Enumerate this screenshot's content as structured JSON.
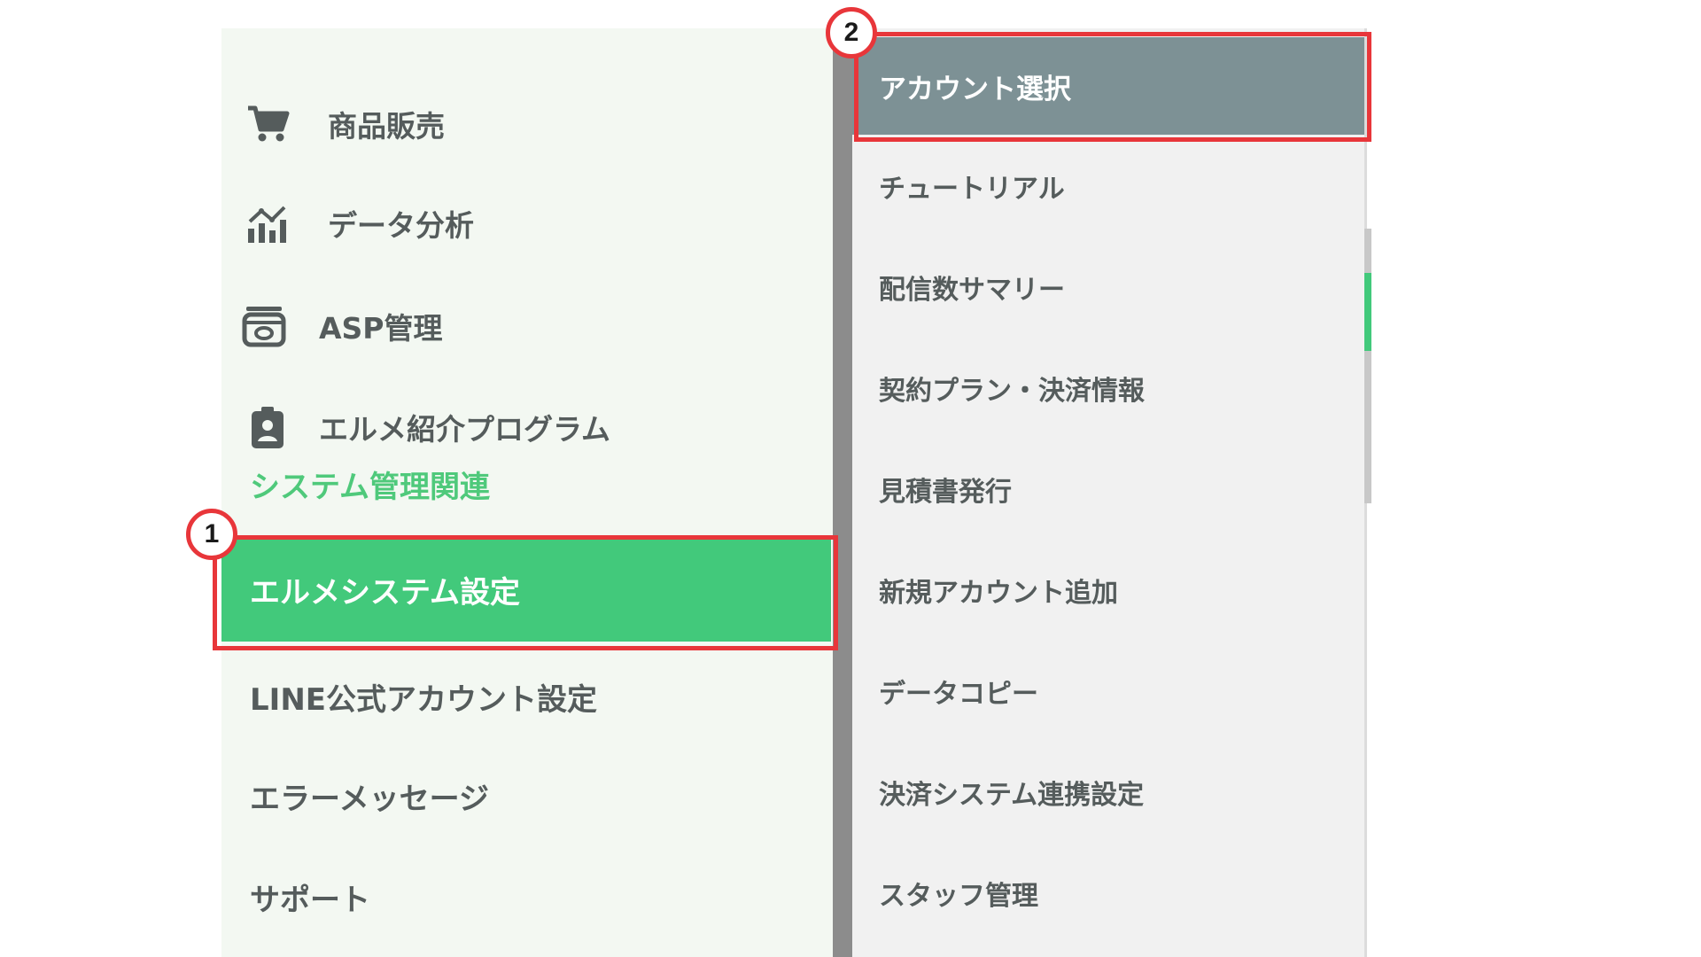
{
  "sidebar": {
    "items": [
      {
        "label": "商品販売",
        "icon": "cart-icon"
      },
      {
        "label": "データ分析",
        "icon": "analytics-chart-icon"
      },
      {
        "label": "ASP管理",
        "icon": "asp-box-icon"
      },
      {
        "label": "エルメ紹介プログラム",
        "icon": "badge-person-icon"
      }
    ],
    "section_label": "システム管理関連",
    "active_item": "エルメシステム設定",
    "plain_items": [
      "LINE公式アカウント設定",
      "エラーメッセージ",
      "サポート"
    ]
  },
  "submenu": {
    "active_item": "アカウント選択",
    "items": [
      "チュートリアル",
      "配信数サマリー",
      "契約プラン・決済情報",
      "見積書発行",
      "新規アカウント追加",
      "データコピー",
      "決済システム連携設定",
      "スタッフ管理"
    ]
  },
  "annotations": {
    "badge_1": "1",
    "badge_2": "2",
    "highlight_color": "#e8363a"
  },
  "colors": {
    "accent_green": "#42c97b",
    "section_green": "#4fc97b",
    "submenu_active": "#7d9195",
    "sidebar_bg": "#f3f8f2",
    "submenu_bg": "#f1f1f1"
  }
}
